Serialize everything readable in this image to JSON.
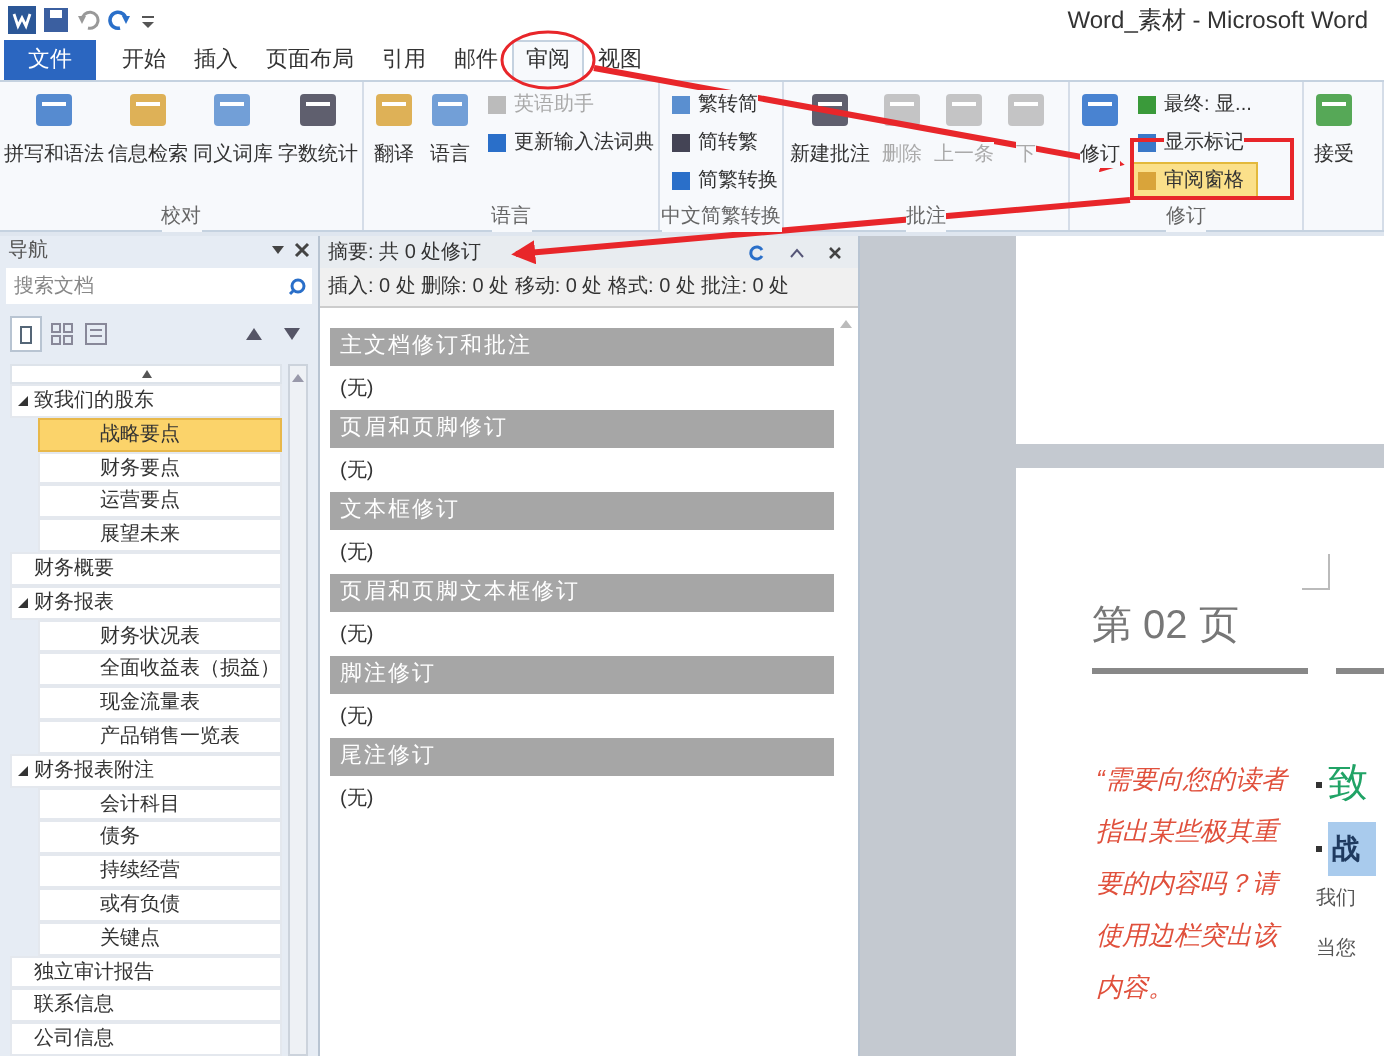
{
  "window": {
    "title": "Word_素材 - Microsoft Word"
  },
  "tabs": [
    {
      "label": "文件",
      "kind": "file",
      "selected": false
    },
    {
      "label": "开始",
      "kind": "tab",
      "selected": false
    },
    {
      "label": "插入",
      "kind": "tab",
      "selected": false
    },
    {
      "label": "页面布局",
      "kind": "tab",
      "selected": false
    },
    {
      "label": "引用",
      "kind": "tab",
      "selected": false
    },
    {
      "label": "邮件",
      "kind": "tab",
      "selected": false
    },
    {
      "label": "审阅",
      "kind": "tab",
      "selected": true
    },
    {
      "label": "视图",
      "kind": "tab",
      "selected": false
    }
  ],
  "ribbon": {
    "groups": [
      {
        "label": "校对",
        "buttons": [
          {
            "label": "拼写和语法",
            "kind": "large",
            "disabled": false,
            "active": false
          },
          {
            "label": "信息检索",
            "kind": "large",
            "disabled": false,
            "active": false
          },
          {
            "label": "同义词库",
            "kind": "large",
            "disabled": false,
            "active": false
          },
          {
            "label": "字数统计",
            "kind": "large",
            "disabled": false,
            "active": false
          }
        ]
      },
      {
        "label": "语言",
        "buttons": [
          {
            "label": "翻译",
            "kind": "large",
            "disabled": false,
            "active": false
          },
          {
            "label": "语言",
            "kind": "large",
            "disabled": false,
            "active": false
          },
          {
            "label": "英语助手",
            "kind": "small",
            "disabled": true,
            "active": false
          },
          {
            "label": "更新输入法词典",
            "kind": "small",
            "disabled": false,
            "active": false
          }
        ]
      },
      {
        "label": "中文简繁转换",
        "buttons": [
          {
            "label": "繁转简",
            "kind": "small",
            "disabled": false,
            "active": false
          },
          {
            "label": "简转繁",
            "kind": "small",
            "disabled": false,
            "active": false
          },
          {
            "label": "简繁转换",
            "kind": "small",
            "disabled": false,
            "active": false
          }
        ]
      },
      {
        "label": "批注",
        "buttons": [
          {
            "label": "新建批注",
            "kind": "large",
            "disabled": false,
            "active": false
          },
          {
            "label": "删除",
            "kind": "large",
            "disabled": true,
            "active": false
          },
          {
            "label": "上一条",
            "kind": "large",
            "disabled": true,
            "active": false
          },
          {
            "label": "下",
            "kind": "large",
            "disabled": true,
            "active": false
          }
        ]
      },
      {
        "label": "修订",
        "buttons": [
          {
            "label": "修订",
            "kind": "large",
            "disabled": false,
            "active": false
          },
          {
            "label": "最终: 显...",
            "kind": "small",
            "disabled": false,
            "active": false
          },
          {
            "label": "显示标记",
            "kind": "small",
            "disabled": false,
            "active": false
          },
          {
            "label": "审阅窗格",
            "kind": "small",
            "disabled": false,
            "active": true
          }
        ]
      },
      {
        "buttons": [
          {
            "label": "接受",
            "kind": "large",
            "disabled": false,
            "active": false
          }
        ]
      }
    ]
  },
  "navigation": {
    "title": "导航",
    "search": {
      "placeholder": "搜索文档"
    },
    "items": [
      {
        "label": "致我们的股东",
        "selected": false,
        "expanded": true,
        "children": [
          {
            "label": "战略要点",
            "selected": true
          },
          {
            "label": "财务要点",
            "selected": false
          },
          {
            "label": "运营要点",
            "selected": false
          },
          {
            "label": "展望未来",
            "selected": false
          }
        ]
      },
      {
        "label": "财务概要",
        "selected": false
      },
      {
        "label": "财务报表",
        "selected": false,
        "expanded": true,
        "children": [
          {
            "label": "财务状况表",
            "selected": false
          },
          {
            "label": "全面收益表（损益）",
            "selected": false
          },
          {
            "label": "现金流量表",
            "selected": false
          },
          {
            "label": "产品销售一览表",
            "selected": false
          }
        ]
      },
      {
        "label": "财务报表附注",
        "selected": false,
        "expanded": true,
        "children": [
          {
            "label": "会计科目",
            "selected": false
          },
          {
            "label": "债务",
            "selected": false
          },
          {
            "label": "持续经营",
            "selected": false
          },
          {
            "label": "或有负债",
            "selected": false
          },
          {
            "label": "关键点",
            "selected": false
          }
        ]
      },
      {
        "label": "独立审计报告",
        "selected": false
      },
      {
        "label": "联系信息",
        "selected": false
      },
      {
        "label": "公司信息",
        "selected": false
      }
    ]
  },
  "review_pane": {
    "summary": "摘要: 共 0 处修订",
    "counts": "插入: 0 处 删除: 0 处 移动: 0 处 格式: 0 处 批注: 0 处",
    "sections": [
      {
        "heading": "主文档修订和批注",
        "body": "(无)"
      },
      {
        "heading": "页眉和页脚修订",
        "body": "(无)"
      },
      {
        "heading": "文本框修订",
        "body": "(无)"
      },
      {
        "heading": "页眉和页脚文本框修订",
        "body": "(无)"
      },
      {
        "heading": "脚注修订",
        "body": "(无)"
      },
      {
        "heading": "尾注修订",
        "body": "(无)"
      }
    ]
  },
  "document": {
    "page_heading": "第 02 页",
    "pull_quote": "“需要向您的读者指出某些极其重要的内容吗？请使用边栏突出该内容。",
    "heading": "致",
    "subheading": "战",
    "body_lines": [
      "我们",
      "当您"
    ]
  }
}
